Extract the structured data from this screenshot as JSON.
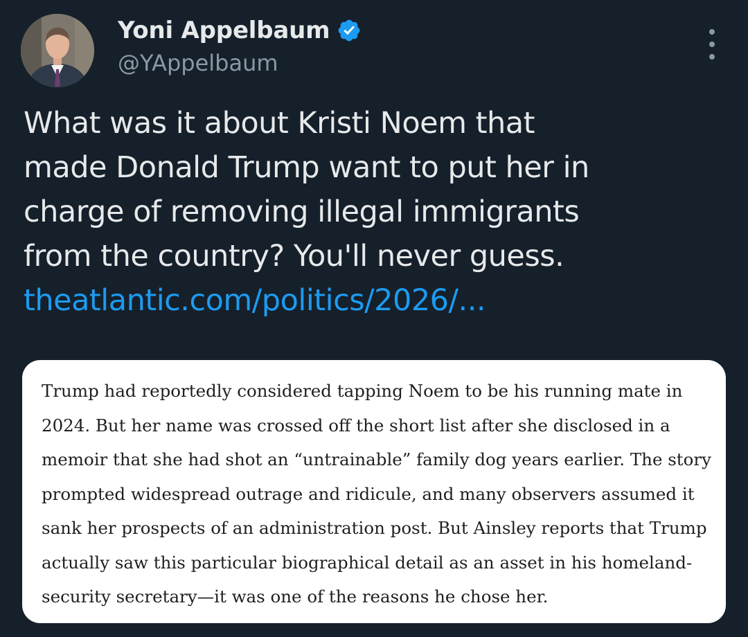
{
  "author": {
    "display_name": "Yoni Appelbaum",
    "handle": "@YAppelbaum",
    "verified": true,
    "avatar_icon": "person-photo-avatar",
    "verified_icon": "verified-badge-icon",
    "menu_icon": "more-vertical-icon"
  },
  "tweet": {
    "text_lines": [
      "What was it about Kristi Noem that",
      "made Donald Trump want to put her in",
      "charge of removing illegal immigrants",
      "from the country? You'll never guess."
    ],
    "link": "theatlantic.com/politics/2026/..."
  },
  "media": {
    "excerpt_lines": [
      "Trump had reportedly considered tapping Noem to be his running mate in",
      "2024. But her name was crossed off the short list after she disclosed in a",
      "memoir that she had shot an “untrainable” family dog years earlier. The story",
      "prompted widespread outrage and ridicule, and many observers assumed it",
      "sank her prospects of an administration post. But Ainsley reports that Trump",
      "actually saw this particular biographical detail as an asset in his homeland-",
      "security secretary—it was one of the reasons he chose her."
    ]
  },
  "colors": {
    "background": "#15202b",
    "link": "#1d9bf0",
    "verified": "#1d9bf0",
    "secondary_text": "#8b98a5"
  }
}
